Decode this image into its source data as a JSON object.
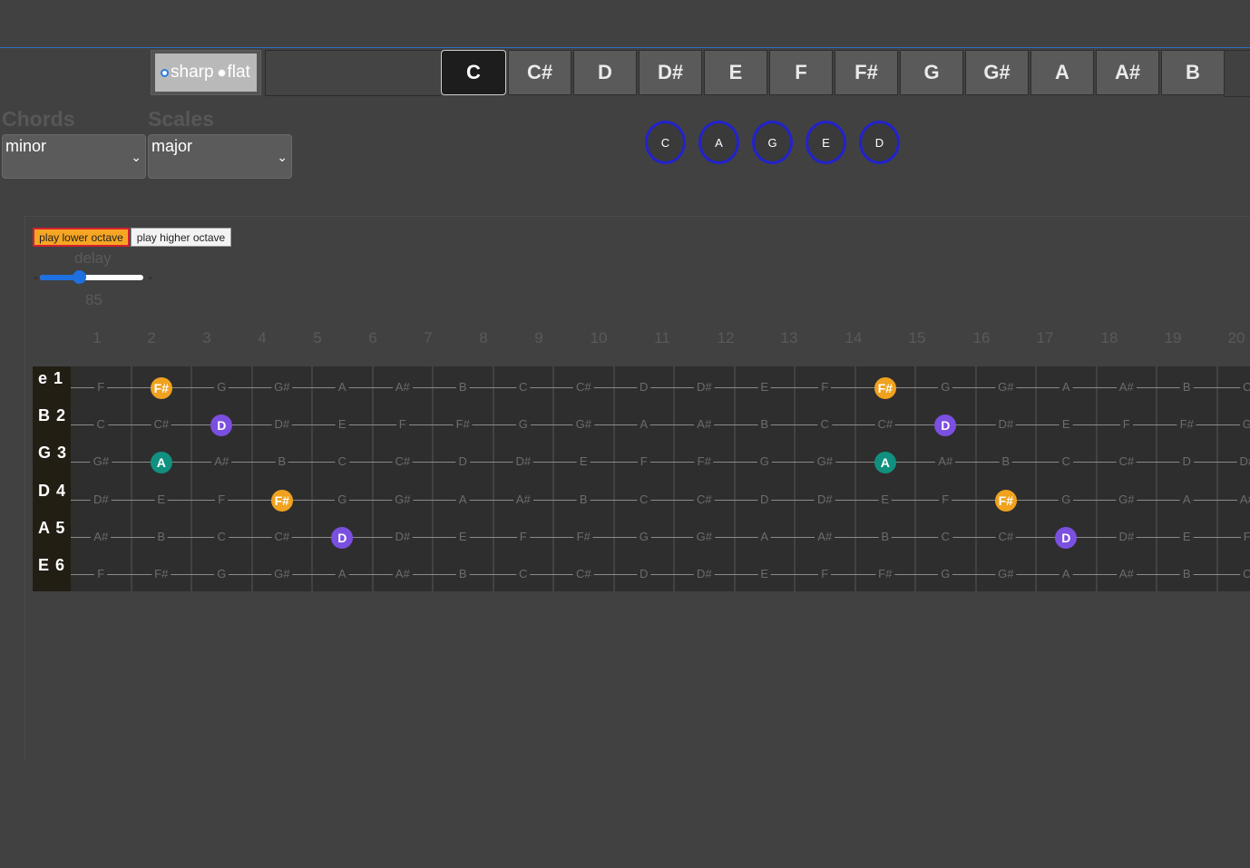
{
  "accidental": {
    "options": [
      "sharp",
      "flat"
    ],
    "selected": "sharp"
  },
  "keys": [
    "C",
    "C#",
    "D",
    "D#",
    "E",
    "F",
    "F#",
    "G",
    "G#",
    "A",
    "A#",
    "B"
  ],
  "selected_key": "C",
  "chords": {
    "label": "Chords",
    "value": "minor"
  },
  "scales": {
    "label": "Scales",
    "value": "major"
  },
  "chord_shapes": [
    "C",
    "A",
    "G",
    "E",
    "D"
  ],
  "player": {
    "play_lower": "play lower octave",
    "play_higher": "play higher octave",
    "delay_label": "delay",
    "delay_value": "85",
    "delay_fraction": 0.34
  },
  "fret_numbers": [
    "1",
    "2",
    "3",
    "4",
    "5",
    "6",
    "7",
    "8",
    "9",
    "10",
    "11",
    "12",
    "13",
    "14",
    "15",
    "16",
    "17",
    "18",
    "19",
    "20"
  ],
  "strings": [
    {
      "name": "e 1",
      "notes": [
        "F",
        "F#",
        "G",
        "G#",
        "A",
        "A#",
        "B",
        "C",
        "C#",
        "D",
        "D#",
        "E",
        "F",
        "F#",
        "G",
        "G#",
        "A",
        "A#",
        "B",
        "C"
      ]
    },
    {
      "name": "B 2",
      "notes": [
        "C",
        "C#",
        "D",
        "D#",
        "E",
        "F",
        "F#",
        "G",
        "G#",
        "A",
        "A#",
        "B",
        "C",
        "C#",
        "D",
        "D#",
        "E",
        "F",
        "F#",
        "G"
      ]
    },
    {
      "name": "G 3",
      "notes": [
        "G#",
        "A",
        "A#",
        "B",
        "C",
        "C#",
        "D",
        "D#",
        "E",
        "F",
        "F#",
        "G",
        "G#",
        "A",
        "A#",
        "B",
        "C",
        "C#",
        "D",
        "D#"
      ]
    },
    {
      "name": "D 4",
      "notes": [
        "D#",
        "E",
        "F",
        "F#",
        "G",
        "G#",
        "A",
        "A#",
        "B",
        "C",
        "C#",
        "D",
        "D#",
        "E",
        "F",
        "F#",
        "G",
        "G#",
        "A",
        "A#"
      ]
    },
    {
      "name": "A 5",
      "notes": [
        "A#",
        "B",
        "C",
        "C#",
        "D",
        "D#",
        "E",
        "F",
        "F#",
        "G",
        "G#",
        "A",
        "A#",
        "B",
        "C",
        "C#",
        "D",
        "D#",
        "E",
        "F"
      ]
    },
    {
      "name": "E 6",
      "notes": [
        "F",
        "F#",
        "G",
        "G#",
        "A",
        "A#",
        "B",
        "C",
        "C#",
        "D",
        "D#",
        "E",
        "F",
        "F#",
        "G",
        "G#",
        "A",
        "A#",
        "B",
        "C"
      ]
    }
  ],
  "highlight_colors": {
    "F#": "#f0a21e",
    "D": "#7b4fe0",
    "A": "#11907f"
  },
  "highlights": [
    {
      "string": 0,
      "fret": 2,
      "note": "F#"
    },
    {
      "string": 0,
      "fret": 14,
      "note": "F#"
    },
    {
      "string": 1,
      "fret": 3,
      "note": "D"
    },
    {
      "string": 1,
      "fret": 15,
      "note": "D"
    },
    {
      "string": 2,
      "fret": 2,
      "note": "A"
    },
    {
      "string": 2,
      "fret": 14,
      "note": "A"
    },
    {
      "string": 3,
      "fret": 4,
      "note": "F#"
    },
    {
      "string": 3,
      "fret": 16,
      "note": "F#"
    },
    {
      "string": 4,
      "fret": 5,
      "note": "D"
    },
    {
      "string": 4,
      "fret": 17,
      "note": "D"
    }
  ]
}
